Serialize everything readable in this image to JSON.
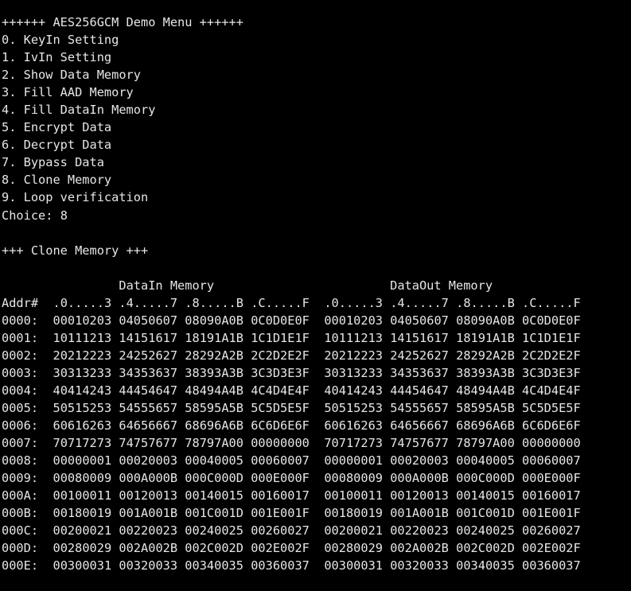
{
  "colors": {
    "background": "#000000",
    "text": "#e6e6e6"
  },
  "menu": {
    "title": "++++++ AES256GCM Demo Menu ++++++",
    "items": [
      "0. KeyIn Setting",
      "1. IvIn Setting",
      "2. Show Data Memory",
      "3. Fill AAD Memory",
      "4. Fill DataIn Memory",
      "5. Encrypt Data",
      "6. Decrypt Data",
      "7. Bypass Data",
      "8. Clone Memory",
      "9. Loop verification"
    ],
    "choice_label": "Choice:",
    "choice_value": "8"
  },
  "section": {
    "title": "+++ Clone Memory +++"
  },
  "table": {
    "datain_title": "DataIn Memory",
    "dataout_title": "DataOut Memory",
    "addr_header": "Addr#",
    "column_headers": [
      ".0.....3",
      ".4.....7",
      ".8.....B",
      ".C.....F"
    ],
    "rows": [
      {
        "addr": "0000:",
        "datain": [
          "00010203",
          "04050607",
          "08090A0B",
          "0C0D0E0F"
        ],
        "dataout": [
          "00010203",
          "04050607",
          "08090A0B",
          "0C0D0E0F"
        ]
      },
      {
        "addr": "0001:",
        "datain": [
          "10111213",
          "14151617",
          "18191A1B",
          "1C1D1E1F"
        ],
        "dataout": [
          "10111213",
          "14151617",
          "18191A1B",
          "1C1D1E1F"
        ]
      },
      {
        "addr": "0002:",
        "datain": [
          "20212223",
          "24252627",
          "28292A2B",
          "2C2D2E2F"
        ],
        "dataout": [
          "20212223",
          "24252627",
          "28292A2B",
          "2C2D2E2F"
        ]
      },
      {
        "addr": "0003:",
        "datain": [
          "30313233",
          "34353637",
          "38393A3B",
          "3C3D3E3F"
        ],
        "dataout": [
          "30313233",
          "34353637",
          "38393A3B",
          "3C3D3E3F"
        ]
      },
      {
        "addr": "0004:",
        "datain": [
          "40414243",
          "44454647",
          "48494A4B",
          "4C4D4E4F"
        ],
        "dataout": [
          "40414243",
          "44454647",
          "48494A4B",
          "4C4D4E4F"
        ]
      },
      {
        "addr": "0005:",
        "datain": [
          "50515253",
          "54555657",
          "58595A5B",
          "5C5D5E5F"
        ],
        "dataout": [
          "50515253",
          "54555657",
          "58595A5B",
          "5C5D5E5F"
        ]
      },
      {
        "addr": "0006:",
        "datain": [
          "60616263",
          "64656667",
          "68696A6B",
          "6C6D6E6F"
        ],
        "dataout": [
          "60616263",
          "64656667",
          "68696A6B",
          "6C6D6E6F"
        ]
      },
      {
        "addr": "0007:",
        "datain": [
          "70717273",
          "74757677",
          "78797A00",
          "00000000"
        ],
        "dataout": [
          "70717273",
          "74757677",
          "78797A00",
          "00000000"
        ]
      },
      {
        "addr": "0008:",
        "datain": [
          "00000001",
          "00020003",
          "00040005",
          "00060007"
        ],
        "dataout": [
          "00000001",
          "00020003",
          "00040005",
          "00060007"
        ]
      },
      {
        "addr": "0009:",
        "datain": [
          "00080009",
          "000A000B",
          "000C000D",
          "000E000F"
        ],
        "dataout": [
          "00080009",
          "000A000B",
          "000C000D",
          "000E000F"
        ]
      },
      {
        "addr": "000A:",
        "datain": [
          "00100011",
          "00120013",
          "00140015",
          "00160017"
        ],
        "dataout": [
          "00100011",
          "00120013",
          "00140015",
          "00160017"
        ]
      },
      {
        "addr": "000B:",
        "datain": [
          "00180019",
          "001A001B",
          "001C001D",
          "001E001F"
        ],
        "dataout": [
          "00180019",
          "001A001B",
          "001C001D",
          "001E001F"
        ]
      },
      {
        "addr": "000C:",
        "datain": [
          "00200021",
          "00220023",
          "00240025",
          "00260027"
        ],
        "dataout": [
          "00200021",
          "00220023",
          "00240025",
          "00260027"
        ]
      },
      {
        "addr": "000D:",
        "datain": [
          "00280029",
          "002A002B",
          "002C002D",
          "002E002F"
        ],
        "dataout": [
          "00280029",
          "002A002B",
          "002C002D",
          "002E002F"
        ]
      },
      {
        "addr": "000E:",
        "datain": [
          "00300031",
          "00320033",
          "00340035",
          "00360037"
        ],
        "dataout": [
          "00300031",
          "00320033",
          "00340035",
          "00360037"
        ]
      }
    ]
  }
}
